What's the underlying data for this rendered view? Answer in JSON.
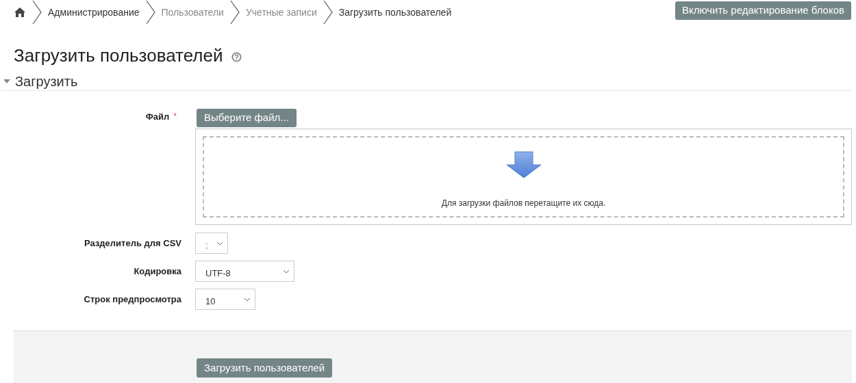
{
  "breadcrumb": [
    {
      "label": "Администрирование",
      "link": true
    },
    {
      "label": "Пользователи",
      "link": false
    },
    {
      "label": "Учетные записи",
      "link": false
    },
    {
      "label": "Загрузить пользователей",
      "link": true
    }
  ],
  "edit_button": "Включить редактирование блоков",
  "page_title": "Загрузить пользователей",
  "section": {
    "title": "Загрузить",
    "expanded": true
  },
  "file_field": {
    "label": "Файл",
    "required_mark": "*",
    "choose_button": "Выберите файл...",
    "drop_hint": "Для загрузки файлов перетащите их сюда."
  },
  "selects": [
    {
      "label": "Разделитель для CSV",
      "value": ";"
    },
    {
      "label": "Кодировка",
      "value": "UTF-8"
    },
    {
      "label": "Строк предпросмотра",
      "value": "10"
    }
  ],
  "submit_button": "Загрузить пользователей"
}
